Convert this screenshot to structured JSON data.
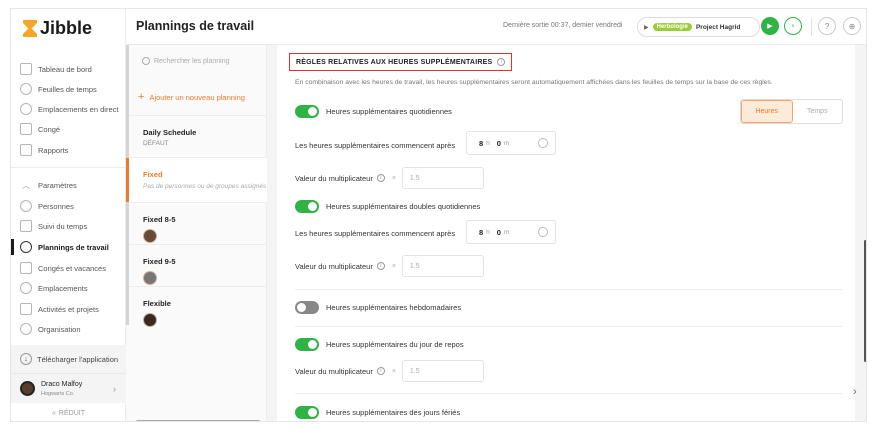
{
  "app": {
    "logo_text": "Jibble"
  },
  "sidebar": {
    "items": [
      {
        "label": "Tableau de bord",
        "icon": "dashboard-icon"
      },
      {
        "label": "Feuilles de temps",
        "icon": "clock-icon"
      },
      {
        "label": "Emplacements en direct",
        "icon": "location-icon"
      },
      {
        "label": "Congé",
        "icon": "calendar-icon"
      },
      {
        "label": "Rapports",
        "icon": "report-icon"
      },
      {
        "label": "Paramètres",
        "icon": "chevron-up-icon"
      },
      {
        "label": "Personnes",
        "icon": "people-icon"
      },
      {
        "label": "Suivi du temps",
        "icon": "time-tracking-icon"
      },
      {
        "label": "Plannings de travail",
        "icon": "schedule-icon",
        "active": true
      },
      {
        "label": "Congés et vacances",
        "icon": "holiday-icon"
      },
      {
        "label": "Emplacements",
        "icon": "location-icon"
      },
      {
        "label": "Activités et projets",
        "icon": "tag-icon"
      },
      {
        "label": "Organisation",
        "icon": "gear-icon"
      }
    ],
    "download_label": "Télécharger l'application",
    "user": {
      "name": "Draco Malfoy",
      "company": "Hogwarts Co."
    },
    "reduce_label": "RÉDUIT"
  },
  "header": {
    "title": "Plannings de travail",
    "last_out": "Dernière sortie 00:37, demier vendredi",
    "activity_tag": "Herbologie",
    "project_name": "Project Hagrid"
  },
  "schedules": {
    "search_placeholder": "Rechercher les planning",
    "add_label": "Ajouter un nouveau planning",
    "items": [
      {
        "name": "Daily Schedule",
        "sub": "DÉFAUT"
      },
      {
        "name": "Fixed",
        "sub": "Pas de personnes ou de groupes assignés",
        "selected": true
      },
      {
        "name": "Fixed 8-5",
        "sub": ""
      },
      {
        "name": "Fixed 9-5",
        "sub": ""
      },
      {
        "name": "Flexible",
        "sub": ""
      }
    ]
  },
  "overtime": {
    "section_title": "RÈGLES RELATIVES AUX HEURES SUPPLÉMENTAIRES",
    "description": "En combinaison avec les heures de travail, les heures supplémentaires seront automatiquement affichées dans les feuilles de temps sur la base de ces règles.",
    "mode_options": [
      "Heures",
      "Temps"
    ],
    "mode_selected": "Heures",
    "daily_label": "Heures supplémentaires quotidiennes",
    "daily_enabled": true,
    "start_after_label": "Les heures supplémentaires commencent après",
    "daily_start_h": "8",
    "daily_start_m": "0",
    "unit_h": "h",
    "unit_m": "m",
    "multiplier_label": "Valeur du multiplicateur",
    "multiplier_x": "×",
    "multiplier_placeholder": "1.5",
    "double_label": "Heures supplémentaires doubles quotidiennes",
    "double_enabled": true,
    "double_start_h": "8",
    "double_start_m": "0",
    "weekly_label": "Heures supplémentaires hebdomadaires",
    "weekly_enabled": false,
    "rest_day_label": "Heures supplémentaires du jour de repos",
    "rest_day_enabled": true,
    "holiday_label": "Heures supplémentaires des jours fériés",
    "holiday_enabled": true
  },
  "colors": {
    "accent": "#f07a2a",
    "success": "#2fb344",
    "highlight_border": "#e03131",
    "tag": "#9ccc3a"
  }
}
